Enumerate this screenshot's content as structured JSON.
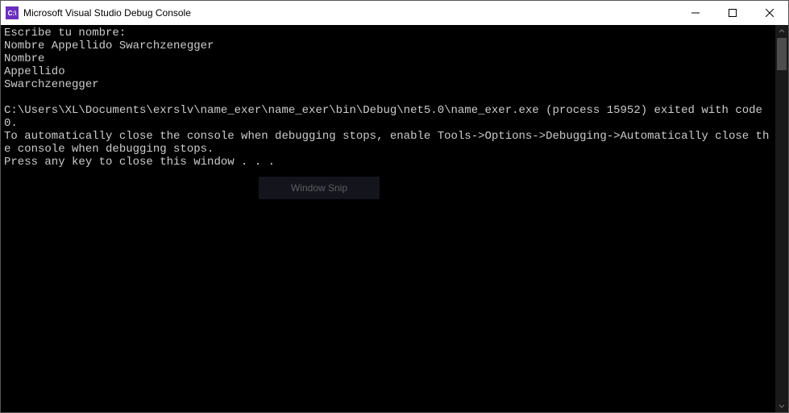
{
  "window": {
    "title": "Microsoft Visual Studio Debug Console",
    "icon_label": "C:\\"
  },
  "overlay": {
    "label": "Window Snip"
  },
  "console": {
    "lines": [
      "Escribe tu nombre:",
      "Nombre Appellido Swarchzenegger",
      "Nombre",
      "Appellido",
      "Swarchzenegger",
      "",
      "C:\\Users\\XL\\Documents\\exrslv\\name_exer\\name_exer\\bin\\Debug\\net5.0\\name_exer.exe (process 15952) exited with code 0.",
      "To automatically close the console when debugging stops, enable Tools->Options->Debugging->Automatically close the console when debugging stops.",
      "Press any key to close this window . . ."
    ]
  }
}
